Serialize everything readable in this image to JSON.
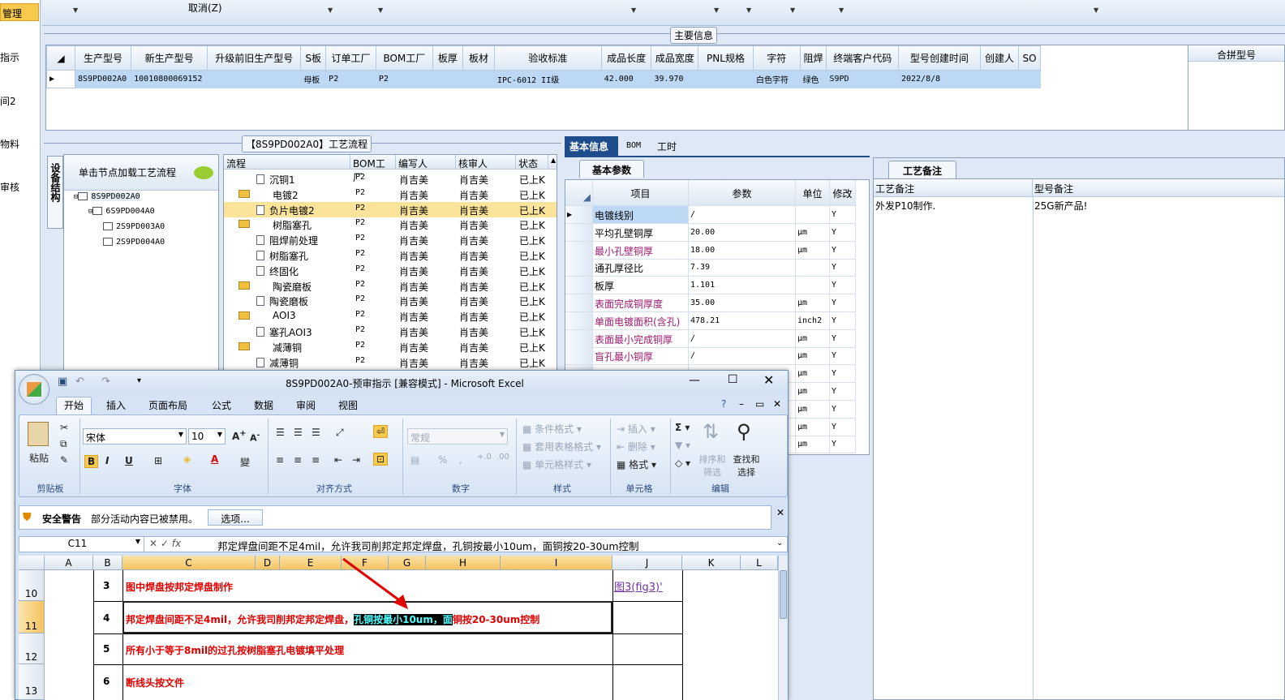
{
  "left_strip": {
    "selected": "管理",
    "items": [
      "指示",
      "间2",
      "物料",
      "审核"
    ]
  },
  "toolbar": {
    "cancel": "取消(Z)"
  },
  "main_info": {
    "title": "主要信息",
    "columns": [
      "生产型号",
      "新生产型号",
      "升级前旧生产型号",
      "S板",
      "订单工厂",
      "BOM工厂",
      "板厚",
      "板材",
      "验收标准",
      "成品长度",
      "成品宽度",
      "PNL规格",
      "字符",
      "阻焊",
      "终端客户代码",
      "型号创建时间",
      "创建人",
      "SO"
    ],
    "row": [
      "8S9PD002A0",
      "10010800069152",
      "",
      "母板",
      "P2",
      "P2",
      "",
      "",
      "IPC-6012 II级",
      "42.000",
      "39.970",
      "",
      "白色字符",
      "绿色",
      "S9PD",
      "2022/8/8",
      "",
      ""
    ],
    "merge_header": "合拼型号"
  },
  "process": {
    "title": "【8S9PD002A0】工艺流程",
    "side_tab": "设备结构",
    "tree_hint": "单击节点加载工艺流程",
    "tree": [
      "8S9PD002A0",
      "6S9PD004A0",
      "2S9PD003A0",
      "2S9PD004A0"
    ],
    "columns": [
      "流程",
      "BOM工厂",
      "编写人",
      "核审人",
      "状态"
    ],
    "rows": [
      {
        "name": "沉铜1",
        "level": 2,
        "bom": "P2",
        "writer": "肖吉美",
        "reviewer": "肖吉美",
        "status": "已上K"
      },
      {
        "name": "电镀2",
        "level": 1,
        "bom": "P2",
        "writer": "肖吉美",
        "reviewer": "肖吉美",
        "status": "已上K"
      },
      {
        "name": "负片电镀2",
        "level": 2,
        "bom": "P2",
        "writer": "肖吉美",
        "reviewer": "肖吉美",
        "status": "已上K",
        "selected": true
      },
      {
        "name": "树脂塞孔",
        "level": 1,
        "bom": "P2",
        "writer": "肖吉美",
        "reviewer": "肖吉美",
        "status": "已上K"
      },
      {
        "name": "阻焊前处理",
        "level": 2,
        "bom": "P2",
        "writer": "肖吉美",
        "reviewer": "肖吉美",
        "status": "已上K"
      },
      {
        "name": "树脂塞孔",
        "level": 2,
        "bom": "P2",
        "writer": "肖吉美",
        "reviewer": "肖吉美",
        "status": "已上K"
      },
      {
        "name": "终固化",
        "level": 2,
        "bom": "P2",
        "writer": "肖吉美",
        "reviewer": "肖吉美",
        "status": "已上K"
      },
      {
        "name": "陶瓷磨板",
        "level": 1,
        "bom": "P2",
        "writer": "肖吉美",
        "reviewer": "肖吉美",
        "status": "已上K"
      },
      {
        "name": "陶瓷磨板",
        "level": 2,
        "bom": "P2",
        "writer": "肖吉美",
        "reviewer": "肖吉美",
        "status": "已上K"
      },
      {
        "name": "AOI3",
        "level": 1,
        "bom": "P2",
        "writer": "肖吉美",
        "reviewer": "肖吉美",
        "status": "已上K"
      },
      {
        "name": "塞孔AOI3",
        "level": 2,
        "bom": "P2",
        "writer": "肖吉美",
        "reviewer": "肖吉美",
        "status": "已上K"
      },
      {
        "name": "减薄铜",
        "level": 1,
        "bom": "P2",
        "writer": "肖吉美",
        "reviewer": "肖吉美",
        "status": "已上K"
      },
      {
        "name": "减薄铜",
        "level": 2,
        "bom": "P2",
        "writer": "肖吉美",
        "reviewer": "肖吉美",
        "status": "已上K"
      }
    ]
  },
  "basic": {
    "tabs": [
      "基本信息",
      "BOM",
      "工时"
    ],
    "sub_tab": "基本参数",
    "columns": [
      "项目",
      "参数",
      "单位",
      "修改"
    ],
    "rows": [
      {
        "item": "电镀线别",
        "param": "/",
        "unit": "",
        "mod": "Y",
        "color": "#000"
      },
      {
        "item": "平均孔壁铜厚",
        "param": "20.00",
        "unit": "μm",
        "mod": "Y",
        "color": "#000"
      },
      {
        "item": "最小孔壁铜厚",
        "param": "18.00",
        "unit": "μm",
        "mod": "Y",
        "color": "#9b1a6e"
      },
      {
        "item": "通孔厚径比",
        "param": "7.39",
        "unit": "",
        "mod": "Y",
        "color": "#000"
      },
      {
        "item": "板厚",
        "param": "1.101",
        "unit": "",
        "mod": "Y",
        "color": "#000"
      },
      {
        "item": "表面完成铜厚度",
        "param": "35.00",
        "unit": "μm",
        "mod": "Y",
        "color": "#9b1a6e"
      },
      {
        "item": "单面电镀面积(含孔)",
        "param": "478.21",
        "unit": "inch2",
        "mod": "Y",
        "color": "#9b1a6e"
      },
      {
        "item": "表面最小完成铜厚",
        "param": "/",
        "unit": "μm",
        "mod": "Y",
        "color": "#9b1a6e"
      },
      {
        "item": "盲孔最小铜厚",
        "param": "/",
        "unit": "μm",
        "mod": "Y",
        "color": "#9b1a6e"
      },
      {
        "item": "",
        "param": "",
        "unit": "μm",
        "mod": "Y",
        "color": "#000"
      },
      {
        "item": "",
        "param": "",
        "unit": "μm",
        "mod": "Y",
        "color": "#000"
      },
      {
        "item": "",
        "param": "",
        "unit": "μm",
        "mod": "Y",
        "color": "#000"
      },
      {
        "item": "",
        "param": "",
        "unit": "μm",
        "mod": "Y",
        "color": "#000"
      },
      {
        "item": "",
        "param": "",
        "unit": "μm",
        "mod": "Y",
        "color": "#000"
      }
    ]
  },
  "remarks": {
    "tab": "工艺备注",
    "col1": "工艺备注",
    "col2": "型号备注",
    "val1": "外发P10制作.",
    "val2": "25G新产品!"
  },
  "excel": {
    "title": "8S9PD002A0-预审指示  [兼容模式] - Microsoft Excel",
    "tabs": [
      "开始",
      "插入",
      "页面布局",
      "公式",
      "数据",
      "审阅",
      "视图"
    ],
    "font": "宋体",
    "size": "10",
    "number_format": "常规",
    "groups": [
      "剪贴板",
      "字体",
      "对齐方式",
      "数字",
      "样式",
      "单元格",
      "编辑"
    ],
    "clipboard_label": "粘贴",
    "style_items": [
      "条件格式",
      "套用表格格式",
      "单元格样式"
    ],
    "cell_items": [
      "插入",
      "删除",
      "格式"
    ],
    "edit_items": [
      "排序和筛选",
      "查找和选择"
    ],
    "security_title": "安全警告",
    "security_text": "部分活动内容已被禁用。",
    "options_button": "选项...",
    "name_box": "C11",
    "formula": "邦定焊盘间距不足4mil，允许我司削邦定邦定焊盘，孔铜按最小10um，面铜按20-30um控制",
    "columns": [
      "A",
      "B",
      "C",
      "D",
      "E",
      "F",
      "G",
      "H",
      "I",
      "J",
      "K",
      "L"
    ],
    "rows": [
      {
        "num": "10",
        "idx": "3",
        "text": "图中焊盘按邦定焊盘制作",
        "link": "图3(fig3)'"
      },
      {
        "num": "11",
        "idx": "4",
        "text_pre": "邦定焊盘间距不足4mil，允许我司削邦定邦定焊盘，",
        "text_hl": "孔铜按最小10um，面",
        "text_post": "铜按20-30um控制"
      },
      {
        "num": "12",
        "idx": "5",
        "text": "所有小于等于8mil的过孔按树脂塞孔电镀填平处理"
      },
      {
        "num": "13",
        "idx": "6",
        "text": "断线头按文件"
      }
    ]
  }
}
